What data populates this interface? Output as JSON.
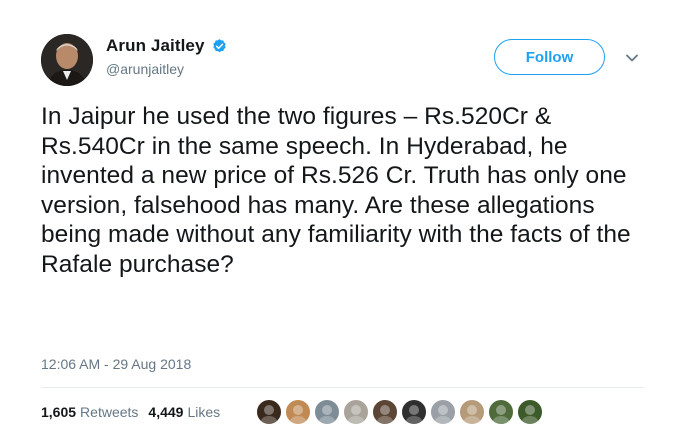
{
  "tweet": {
    "display_name": "Arun Jaitley",
    "handle": "@arunjaitley",
    "verified_icon": "verified-badge-icon",
    "follow_label": "Follow",
    "text": "In Jaipur he used the two figures – Rs.520Cr & Rs.540Cr in the same speech. In Hyderabad, he invented a new price of Rs.526 Cr. Truth has only one version, falsehood has many. Are these allegations being made without any familiarity with the facts of the Rafale purchase?",
    "timestamp": "12:06 AM - 29 Aug 2018"
  },
  "stats": {
    "retweets_count": "1,605",
    "retweets_label": "Retweets",
    "likes_count": "4,449",
    "likes_label": "Likes"
  },
  "colors": {
    "accent": "#1da1f2",
    "secondary_text": "#657786",
    "primary_text": "#14171a"
  },
  "liker_avatars": [
    {
      "icon": "avatar-icon",
      "color": "#3a2a1e"
    },
    {
      "icon": "avatar-icon",
      "color": "#c08a55"
    },
    {
      "icon": "avatar-icon",
      "color": "#7d8c96"
    },
    {
      "icon": "avatar-icon",
      "color": "#a9a39b"
    },
    {
      "icon": "avatar-icon",
      "color": "#5b4636"
    },
    {
      "icon": "avatar-icon",
      "color": "#2f2f2f"
    },
    {
      "icon": "avatar-icon",
      "color": "#9aa0a6"
    },
    {
      "icon": "avatar-icon",
      "color": "#b59b7a"
    },
    {
      "icon": "avatar-icon",
      "color": "#4f6b3b"
    },
    {
      "icon": "avatar-icon",
      "color": "#3c5a2a"
    }
  ]
}
